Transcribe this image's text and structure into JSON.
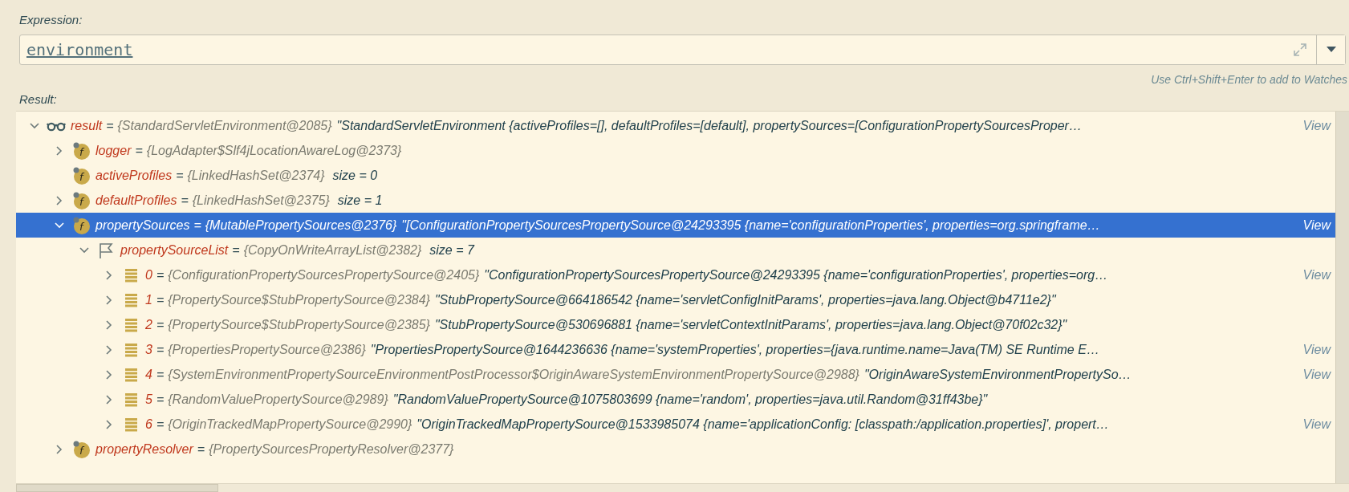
{
  "expression": {
    "label": "Expression:",
    "value": "environment",
    "hint": "Use Ctrl+Shift+Enter to add to Watches"
  },
  "result_label": "Result:",
  "tree": [
    {
      "kind": "watch",
      "name": "result",
      "op": "=",
      "type": "{StandardServletEnvironment@2085}",
      "value": "\"StandardServletEnvironment {activeProfiles=[], defaultProfiles=[default], propertySources=[ConfigurationPropertySourcesProper…",
      "view": "View",
      "expanded": true,
      "selected": false,
      "children": [
        {
          "kind": "field",
          "icon_text": "f",
          "name": "logger",
          "op": "=",
          "type": "{LogAdapter$Slf4jLocationAwareLog@2373}",
          "expanded": false,
          "selected": false
        },
        {
          "kind": "field",
          "icon_text": "f",
          "name": "activeProfiles",
          "op": "=",
          "type": "{LinkedHashSet@2374}",
          "size": "size = 0",
          "selected": false
        },
        {
          "kind": "field",
          "icon_text": "f",
          "name": "defaultProfiles",
          "op": "=",
          "type": "{LinkedHashSet@2375}",
          "size": "size = 1",
          "expanded": false,
          "selected": false
        },
        {
          "kind": "field",
          "icon_text": "f",
          "name": "propertySources",
          "op": "=",
          "type": "{MutablePropertySources@2376}",
          "value": "\"[ConfigurationPropertySourcesPropertySource@24293395 {name='configurationProperties', properties=org.springframe…",
          "view": "View",
          "expanded": true,
          "selected": true,
          "children": [
            {
              "kind": "list",
              "name": "propertySourceList",
              "op": "=",
              "type": "{CopyOnWriteArrayList@2382}",
              "size": "size = 7",
              "expanded": true,
              "selected": false,
              "children": [
                {
                  "kind": "element",
                  "name": "0",
                  "op": "=",
                  "type": "{ConfigurationPropertySourcesPropertySource@2405}",
                  "value": "\"ConfigurationPropertySourcesPropertySource@24293395 {name='configurationProperties', properties=org…",
                  "view": "View",
                  "expanded": false,
                  "selected": false
                },
                {
                  "kind": "element",
                  "name": "1",
                  "op": "=",
                  "type": "{PropertySource$StubPropertySource@2384}",
                  "value": "\"StubPropertySource@664186542 {name='servletConfigInitParams', properties=java.lang.Object@b4711e2}\"",
                  "expanded": false,
                  "selected": false
                },
                {
                  "kind": "element",
                  "name": "2",
                  "op": "=",
                  "type": "{PropertySource$StubPropertySource@2385}",
                  "value": "\"StubPropertySource@530696881 {name='servletContextInitParams', properties=java.lang.Object@70f02c32}\"",
                  "expanded": false,
                  "selected": false
                },
                {
                  "kind": "element",
                  "name": "3",
                  "op": "=",
                  "type": "{PropertiesPropertySource@2386}",
                  "value": "\"PropertiesPropertySource@1644236636 {name='systemProperties', properties={java.runtime.name=Java(TM) SE Runtime E…",
                  "view": "View",
                  "expanded": false,
                  "selected": false
                },
                {
                  "kind": "element",
                  "name": "4",
                  "op": "=",
                  "type": "{SystemEnvironmentPropertySourceEnvironmentPostProcessor$OriginAwareSystemEnvironmentPropertySource@2988}",
                  "value": "\"OriginAwareSystemEnvironmentPropertySo…",
                  "view": "View",
                  "expanded": false,
                  "selected": false
                },
                {
                  "kind": "element",
                  "name": "5",
                  "op": "=",
                  "type": "{RandomValuePropertySource@2989}",
                  "value": "\"RandomValuePropertySource@1075803699 {name='random', properties=java.util.Random@31ff43be}\"",
                  "expanded": false,
                  "selected": false
                },
                {
                  "kind": "element",
                  "name": "6",
                  "op": "=",
                  "type": "{OriginTrackedMapPropertySource@2990}",
                  "value": "\"OriginTrackedMapPropertySource@1533985074 {name='applicationConfig: [classpath:/application.properties]', propert…",
                  "view": "View",
                  "expanded": false,
                  "selected": false
                }
              ]
            }
          ]
        },
        {
          "kind": "field",
          "icon_text": "f",
          "name": "propertyResolver",
          "op": "=",
          "type": "{PropertySourcesPropertyResolver@2377}",
          "expanded": false,
          "selected": false
        }
      ]
    }
  ]
}
